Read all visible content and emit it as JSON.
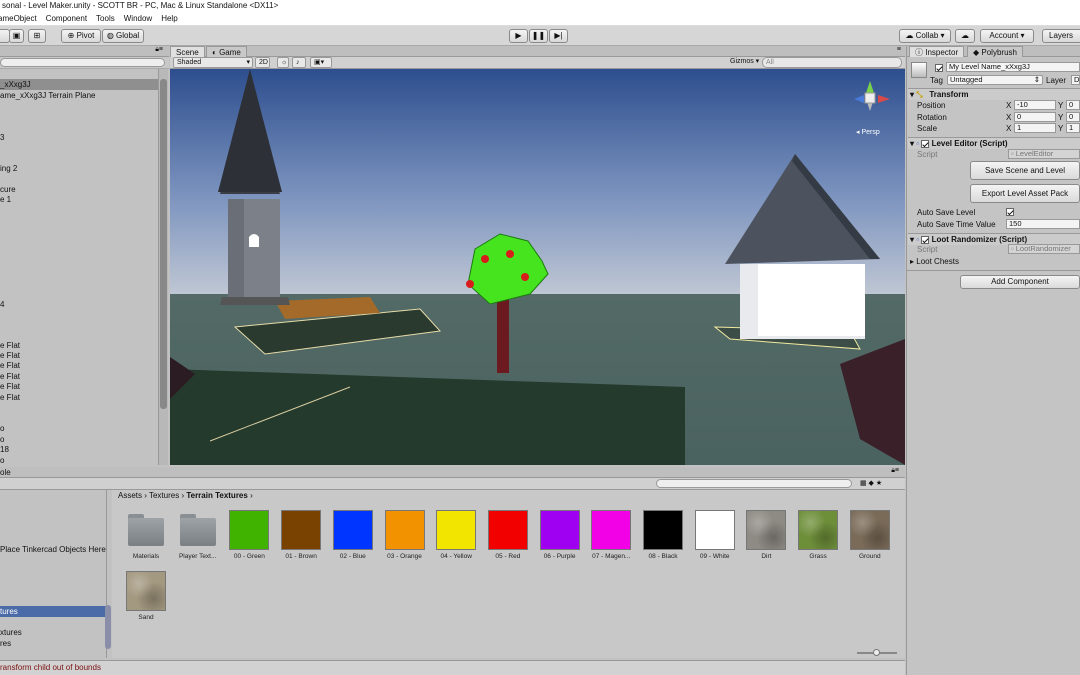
{
  "window": {
    "title": "sonal - Level Maker.unity - SCOTT BR - PC, Mac & Linux Standalone <DX11>"
  },
  "menu": [
    "ameObject",
    "Component",
    "Tools",
    "Window",
    "Help"
  ],
  "toolbar": {
    "pivot": "Pivot",
    "global": "Global",
    "collab": "Collab",
    "account": "Account",
    "layers": "Layers"
  },
  "scene_tabs": {
    "scene": "Scene",
    "game": "Game",
    "shading": "Shaded",
    "mode_2d": "2D",
    "gizmos": "Gizmos",
    "search_placeholder": "All",
    "persp": "Persp"
  },
  "hierarchy": {
    "rows": [
      {
        "text": "_xXxg3J",
        "selected": true
      },
      {
        "text": "ame_xXxg3J Terrain Plane",
        "selected": false
      },
      {
        "text": "3",
        "selected": false
      },
      {
        "text": "ing 2",
        "selected": false
      },
      {
        "text": "cure",
        "selected": false
      },
      {
        "text": "e 1",
        "selected": false
      },
      {
        "text": "4",
        "selected": false
      },
      {
        "text": "e Flat",
        "selected": false
      },
      {
        "text": "e Flat",
        "selected": false
      },
      {
        "text": "e Flat",
        "selected": false
      },
      {
        "text": "e Flat",
        "selected": false
      },
      {
        "text": "e Flat",
        "selected": false
      },
      {
        "text": "e Flat",
        "selected": false
      },
      {
        "text": "o",
        "selected": false
      },
      {
        "text": "o",
        "selected": false
      },
      {
        "text": "18",
        "selected": false
      },
      {
        "text": "o",
        "selected": false
      }
    ]
  },
  "project": {
    "tab": "ole",
    "breadcrumb": [
      "Assets",
      "Textures",
      "Terrain Textures"
    ],
    "left_rows": [
      {
        "text": "Place Tinkercad Objects Here",
        "selected": false
      },
      {
        "text": "tures",
        "selected": true
      },
      {
        "text": "xtures",
        "selected": false
      },
      {
        "text": "res",
        "selected": false
      }
    ],
    "assets": [
      {
        "name": "Materials",
        "kind": "folder",
        "color": ""
      },
      {
        "name": "Player Text...",
        "kind": "folder",
        "color": ""
      },
      {
        "name": "00 - Green",
        "kind": "color",
        "color": "#3fb300"
      },
      {
        "name": "01 - Brown",
        "kind": "color",
        "color": "#7a4200"
      },
      {
        "name": "02 - Blue",
        "kind": "color",
        "color": "#0034ff"
      },
      {
        "name": "03 - Orange",
        "kind": "color",
        "color": "#f29200"
      },
      {
        "name": "04 - Yellow",
        "kind": "color",
        "color": "#f2e600"
      },
      {
        "name": "05 - Red",
        "kind": "color",
        "color": "#f20000"
      },
      {
        "name": "06 - Purple",
        "kind": "color",
        "color": "#a000f2"
      },
      {
        "name": "07 - Magen...",
        "kind": "color",
        "color": "#f200e6"
      },
      {
        "name": "08 - Black",
        "kind": "color",
        "color": "#000000"
      },
      {
        "name": "09 - White",
        "kind": "color",
        "color": "#ffffff"
      },
      {
        "name": "Dirt",
        "kind": "texture",
        "color": "#8e8a84"
      },
      {
        "name": "Grass",
        "kind": "texture",
        "color": "#6e8f3a"
      },
      {
        "name": "Ground",
        "kind": "texture",
        "color": "#7a6a58"
      },
      {
        "name": "Sand",
        "kind": "texture",
        "color": "#a39880"
      }
    ]
  },
  "status": {
    "message": "ransform child out of bounds"
  },
  "inspector": {
    "tab_inspector": "Inspector",
    "tab_polybrush": "Polybrush",
    "object_name": "My Level Name_xXxg3J",
    "tag_label": "Tag",
    "tag_value": "Untagged",
    "layer_label": "Layer",
    "layer_value": "D",
    "transform": {
      "title": "Transform",
      "position_label": "Position",
      "rotation_label": "Rotation",
      "scale_label": "Scale",
      "x_label": "X",
      "y_label": "Y",
      "pos_x": "-10",
      "pos_y": "0",
      "rot_x": "0",
      "rot_y": "0",
      "scl_x": "1",
      "scl_y": "1"
    },
    "level_editor": {
      "title": "Level Editor (Script)",
      "script_label": "Script",
      "script_value": "LevelEditor",
      "save_button": "Save Scene and Level",
      "export_button": "Export Level Asset Pack",
      "auto_save_label": "Auto Save Level",
      "auto_save_time_label": "Auto Save Time Value",
      "auto_save_time_value": "150"
    },
    "loot": {
      "title": "Loot Randomizer (Script)",
      "script_label": "Script",
      "script_value": "LootRandomizer",
      "chests_label": "Loot Chests"
    },
    "add_component": "Add Component"
  }
}
